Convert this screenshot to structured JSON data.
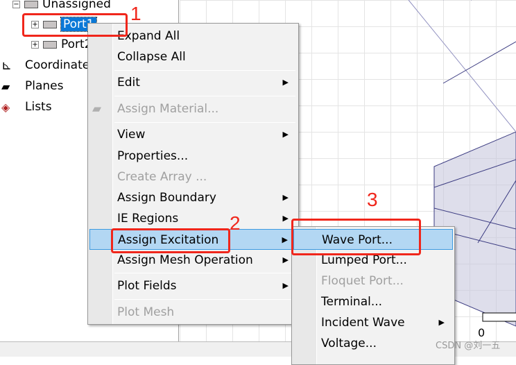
{
  "tree": {
    "items": [
      {
        "label": "Unassigned",
        "expander": "−"
      },
      {
        "label": "Port1",
        "expander": "+",
        "selected": true
      },
      {
        "label": "Port2",
        "expander": "+"
      },
      {
        "label": "Coordinate Systems",
        "icon": "coordinate-axes-icon"
      },
      {
        "label": "Planes",
        "icon": "planes-icon"
      },
      {
        "label": "Lists",
        "icon": "lists-icon"
      }
    ]
  },
  "context_menu": {
    "items": [
      {
        "label": "Expand All"
      },
      {
        "label": "Collapse All"
      },
      {
        "label": "Edit",
        "submenu": true
      },
      {
        "label": "Assign Material...",
        "disabled": true
      },
      {
        "label": "View",
        "submenu": true
      },
      {
        "label": "Properties..."
      },
      {
        "label": "Create Array ...",
        "disabled": true
      },
      {
        "label": "Assign Boundary",
        "submenu": true
      },
      {
        "label": "IE Regions",
        "submenu": true
      },
      {
        "label": "Assign Excitation",
        "submenu": true,
        "highlighted": true
      },
      {
        "label": "Assign Mesh Operation",
        "submenu": true
      },
      {
        "label": "Plot Fields",
        "submenu": true
      },
      {
        "label": "Plot Mesh",
        "disabled": true
      }
    ]
  },
  "submenu": {
    "items": [
      {
        "label": "Wave Port...",
        "highlighted": true
      },
      {
        "label": "Lumped Port..."
      },
      {
        "label": "Floquet Port...",
        "disabled": true
      },
      {
        "label": "Terminal..."
      },
      {
        "label": "Incident Wave",
        "submenu": true
      },
      {
        "label": "Voltage..."
      }
    ]
  },
  "annotations": [
    "1",
    "2",
    "3"
  ],
  "scale_label": "0",
  "watermark": "CSDN @刘一五",
  "colors": {
    "annotation": "#f0261b",
    "highlight": "#b3d7f3",
    "selection": "#0a78d7"
  }
}
